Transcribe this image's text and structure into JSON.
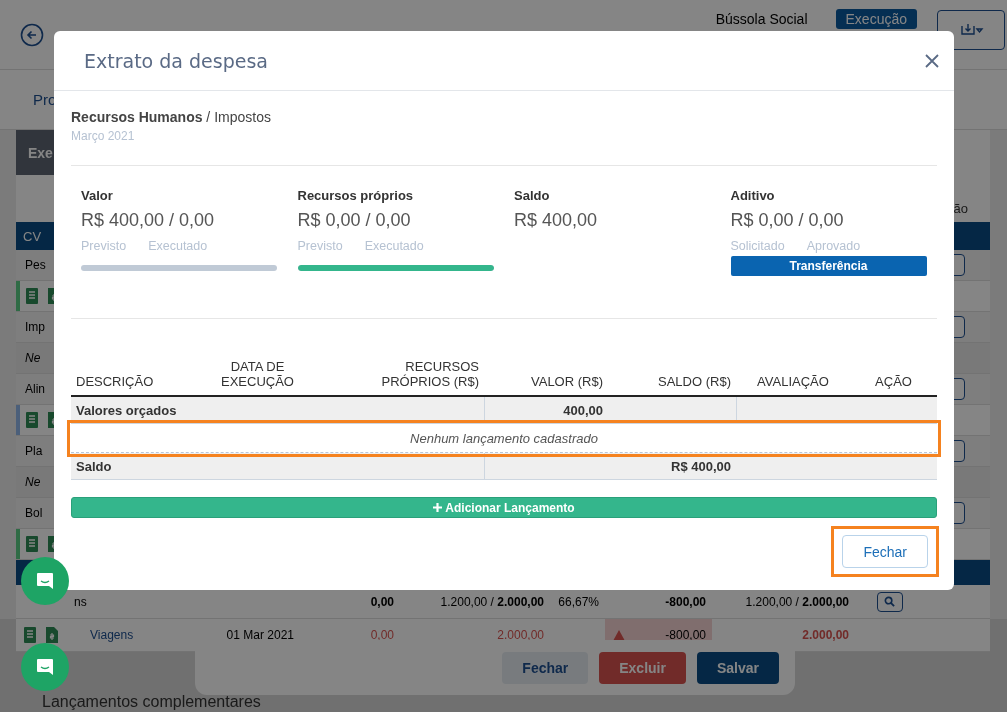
{
  "background": {
    "brand": "Bússola Social",
    "status_badge": "Execução",
    "nav_tab": "Pro",
    "panel_title": "Exe",
    "header_right": "ão",
    "first_column": "CV",
    "rows": [
      {
        "kind": "text",
        "label": "Pes"
      },
      {
        "kind": "icons",
        "color": "#2f6b45"
      },
      {
        "kind": "text",
        "label": "Imp"
      },
      {
        "kind": "note",
        "label": "Ne"
      },
      {
        "kind": "text",
        "label": "Alin"
      },
      {
        "kind": "icons",
        "color": "#4b5f7a"
      },
      {
        "kind": "text",
        "label": "Pla"
      },
      {
        "kind": "note",
        "label": "Ne"
      },
      {
        "kind": "text",
        "label": "Bol"
      },
      {
        "kind": "icons",
        "color": "#2f6b45"
      },
      {
        "kind": "band"
      }
    ],
    "total_row": {
      "label": "ns",
      "cells": [
        "**0,00**",
        "1.200,00 / **2.000,00**",
        "66,67%",
        "**-800,00**",
        "1.200,00 / **2.000,00**"
      ]
    },
    "item_row": {
      "label": "Viagens",
      "date": "01 Mar 2021",
      "cells": [
        "0,00",
        "2.000,00",
        "-800,00",
        "2.000,00"
      ]
    },
    "dialog_buttons": [
      {
        "kind": "secondary",
        "label": "Fechar"
      },
      {
        "kind": "danger",
        "label": "Excluir"
      },
      {
        "kind": "primary",
        "label": "Salvar"
      }
    ],
    "section_title": "Lançamentos complementares"
  },
  "modal": {
    "title": "Extrato da despesa",
    "category": "**Recursos Humanos** / Impostos",
    "period": "Março 2021",
    "stats": [
      {
        "kind": "progress",
        "label": "Valor",
        "value": "R$ 400,00 / 0,00",
        "sublabels": [
          "Previsto",
          "Executado"
        ],
        "level": 0
      },
      {
        "kind": "progress",
        "label": "Recursos próprios",
        "value": "R$ 0,00 / 0,00",
        "sublabels": [
          "Previsto",
          "Executado"
        ],
        "level": 1
      },
      {
        "kind": "plain",
        "label": "Saldo",
        "value": "R$ 400,00"
      },
      {
        "kind": "transfer",
        "label": "Aditivo",
        "value": "R$ 0,00 / 0,00",
        "sublabels": [
          "Solicitado",
          "Aprovado"
        ],
        "button": "Transferência"
      }
    ],
    "table": {
      "columns": [
        {
          "lines": [
            "DESCRIÇÃO"
          ]
        },
        {
          "lines": [
            "DATA DE",
            "EXECUÇÃO"
          ]
        },
        {
          "lines": [
            "RECURSOS",
            "PRÓPRIOS (R$)"
          ]
        },
        {
          "lines": [
            "VALOR (R$)"
          ]
        },
        {
          "lines": [
            "SALDO (R$)"
          ]
        },
        {
          "lines": [
            "AVALIAÇÃO"
          ]
        },
        {
          "lines": [
            "AÇÃO"
          ]
        }
      ],
      "budget_row": {
        "label": "Valores orçados",
        "value": "400,00"
      },
      "empty_message": {
        "text": "Nenhum lançamento cadastrado",
        "highlighted": true
      },
      "balance_row": {
        "label": "Saldo",
        "value": "R$ 400,00"
      }
    },
    "add_button": "Adicionar Lançamento",
    "close_button": {
      "label": "Fechar",
      "highlighted": true
    }
  }
}
